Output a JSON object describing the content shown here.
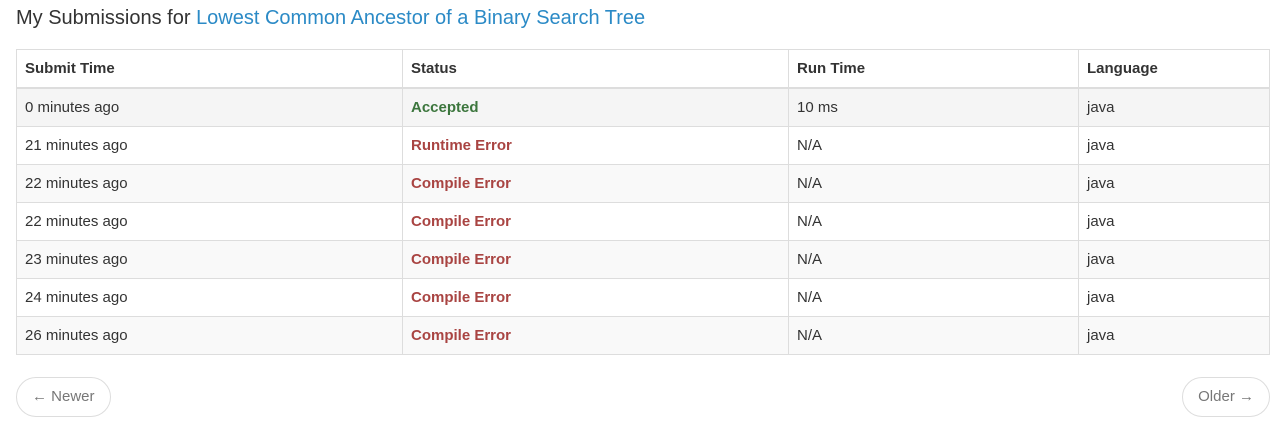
{
  "header": {
    "prefix": "My Submissions for ",
    "problem_link": "Lowest Common Ancestor of a Binary Search Tree"
  },
  "table": {
    "columns": [
      "Submit Time",
      "Status",
      "Run Time",
      "Language"
    ],
    "rows": [
      {
        "time": "0 minutes ago",
        "status": "Accepted",
        "runtime": "10 ms",
        "language": "java"
      },
      {
        "time": "21 minutes ago",
        "status": "Runtime Error",
        "runtime": "N/A",
        "language": "java"
      },
      {
        "time": "22 minutes ago",
        "status": "Compile Error",
        "runtime": "N/A",
        "language": "java"
      },
      {
        "time": "22 minutes ago",
        "status": "Compile Error",
        "runtime": "N/A",
        "language": "java"
      },
      {
        "time": "23 minutes ago",
        "status": "Compile Error",
        "runtime": "N/A",
        "language": "java"
      },
      {
        "time": "24 minutes ago",
        "status": "Compile Error",
        "runtime": "N/A",
        "language": "java"
      },
      {
        "time": "26 minutes ago",
        "status": "Compile Error",
        "runtime": "N/A",
        "language": "java"
      }
    ]
  },
  "pager": {
    "newer_label": "← Newer",
    "older_label": "Older →"
  },
  "colors": {
    "link": "#2b8ac6",
    "accepted": "#3c763d",
    "error": "#a94442"
  }
}
